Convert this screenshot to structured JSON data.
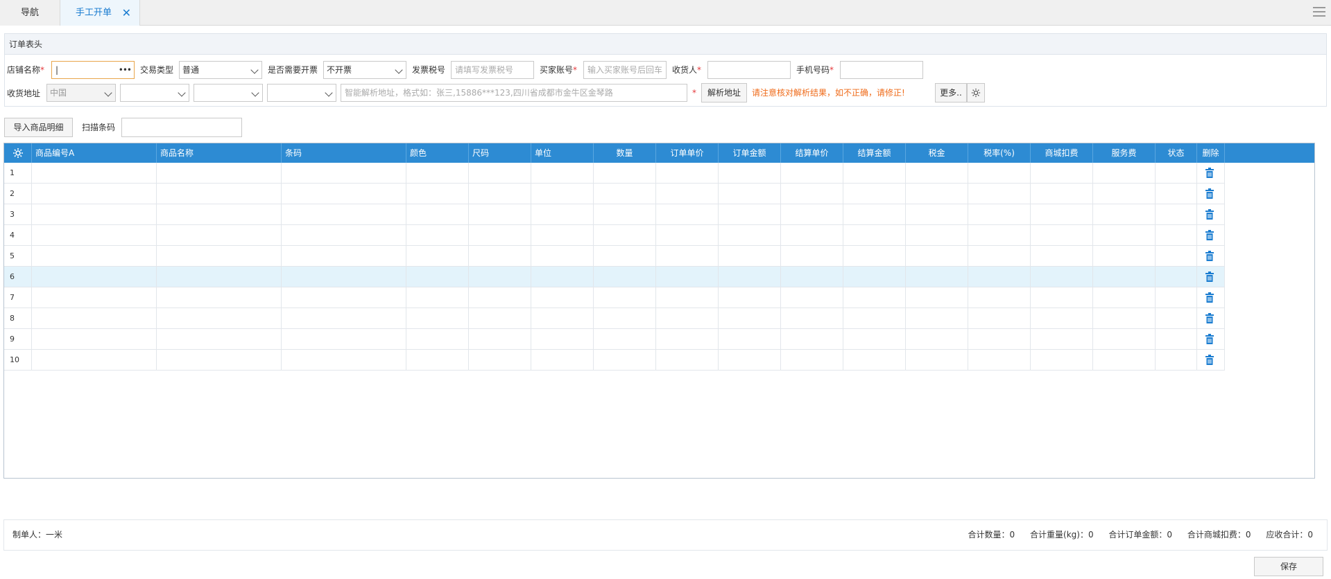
{
  "tabs": {
    "nav": "导航",
    "active": "手工开单"
  },
  "panel_title": "订单表头",
  "form": {
    "shop_name_label": "店铺名称",
    "trade_type_label": "交易类型",
    "trade_type_value": "普通",
    "need_invoice_label": "是否需要开票",
    "need_invoice_value": "不开票",
    "invoice_tax_label": "发票税号",
    "invoice_tax_placeholder": "请填写发票税号",
    "buyer_account_label": "买家账号",
    "buyer_account_placeholder": "输入买家账号后回车",
    "receiver_label": "收货人",
    "phone_label": "手机号码",
    "address_label": "收货地址",
    "country_value": "中国",
    "address_placeholder": "智能解析地址，格式如：张三,15886***123,四川省成都市金牛区金琴路",
    "required_mark": "*",
    "parse_button": "解析地址",
    "parse_warning": "请注意核对解析结果，如不正确，请修正!",
    "more_button": "更多.."
  },
  "toolbar": {
    "import_button": "导入商品明细",
    "scan_label": "扫描条码"
  },
  "grid": {
    "columns": [
      "商品编号A",
      "商品名称",
      "条码",
      "颜色",
      "尺码",
      "单位",
      "数量",
      "订单单价",
      "订单金额",
      "结算单价",
      "结算金额",
      "税金",
      "税率(%)",
      "商城扣费",
      "服务费",
      "状态",
      "删除"
    ],
    "rows": [
      "1",
      "2",
      "3",
      "4",
      "5",
      "6",
      "7",
      "8",
      "9",
      "10"
    ],
    "highlighted_row": 6
  },
  "footer": {
    "maker": "制单人：一米",
    "total_qty": "合计数量：0",
    "total_weight": "合计重量(kg)：0",
    "total_amount": "合计订单金额：0",
    "total_fee": "合计商城扣费：0",
    "total_receivable": "应收合计：0"
  },
  "save_button": "保存",
  "colors": {
    "header_blue": "#2d8bd3",
    "tab_active": "#1a7cd0",
    "warning": "#ef6b1a",
    "row_highlight": "#e3f3fb"
  }
}
